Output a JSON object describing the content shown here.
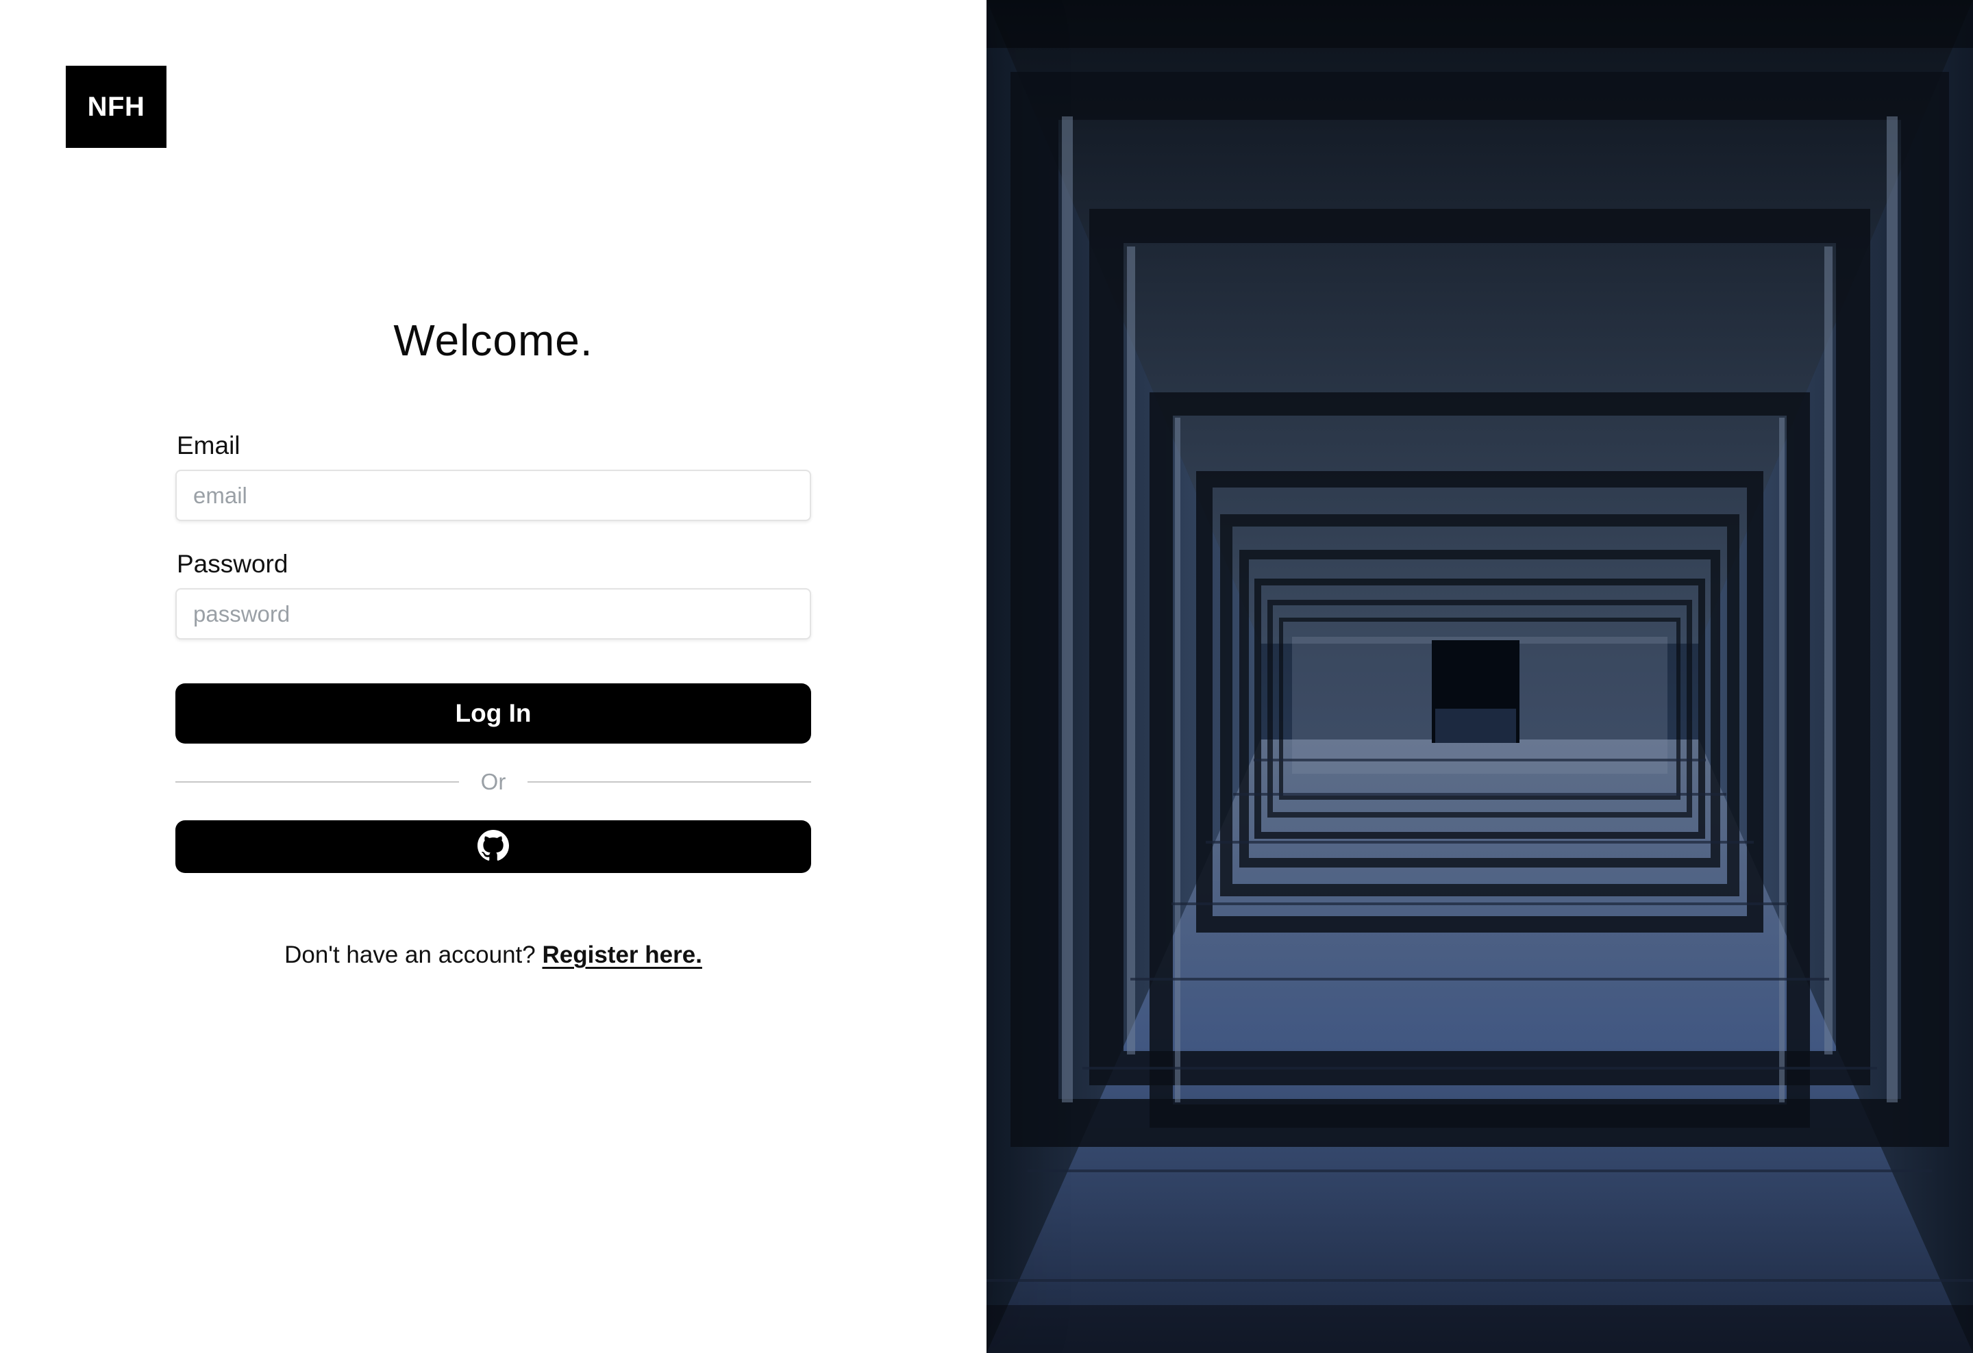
{
  "logo": {
    "text": "NFH"
  },
  "heading": "Welcome.",
  "email": {
    "label": "Email",
    "placeholder": "email",
    "value": ""
  },
  "password": {
    "label": "Password",
    "placeholder": "password",
    "value": ""
  },
  "login_button": {
    "label": "Log In"
  },
  "divider": {
    "text": "Or"
  },
  "github_button": {
    "icon": "github-icon"
  },
  "register": {
    "prompt": "Don't have an account?",
    "link": "Register here."
  },
  "hero_image": {
    "subject": "corridor-photo"
  },
  "colors": {
    "primary": "#000000",
    "background": "#ffffff",
    "placeholder": "#9aa0a6",
    "divider": "#c7c7c7",
    "image_tone": "#3b4f72"
  }
}
